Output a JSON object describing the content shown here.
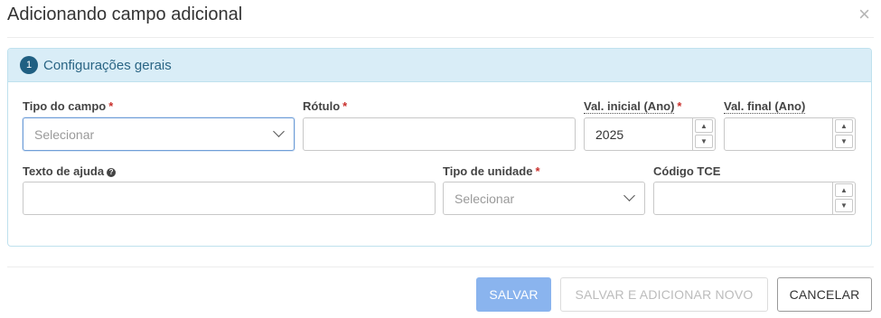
{
  "modal": {
    "title": "Adicionando campo adicional",
    "close_icon": "×"
  },
  "panel": {
    "step_number": "1",
    "title": "Configurações gerais"
  },
  "fields": {
    "tipo_campo": {
      "label": "Tipo do campo",
      "required": "*",
      "placeholder": "Selecionar"
    },
    "rotulo": {
      "label": "Rótulo",
      "required": "*",
      "value": ""
    },
    "val_inicial": {
      "label": "Val. inicial (Ano)",
      "required": "*",
      "value": "2025"
    },
    "val_final": {
      "label": "Val. final (Ano)",
      "value": ""
    },
    "texto_ajuda": {
      "label": "Texto de ajuda",
      "help_icon": "question-circle-icon",
      "value": ""
    },
    "tipo_unidade": {
      "label": "Tipo de unidade",
      "required": "*",
      "placeholder": "Selecionar"
    },
    "codigo_tce": {
      "label": "Código TCE",
      "value": ""
    }
  },
  "buttons": {
    "save": "SALVAR",
    "save_new": "SALVAR E ADICIONAR NOVO",
    "cancel": "CANCELAR"
  },
  "colors": {
    "panel_header_bg": "#d9edf7",
    "panel_title": "#2a6584",
    "step_badge": "#1f5f82",
    "required": "#c9302c",
    "save_button": "#8ab4ee"
  }
}
